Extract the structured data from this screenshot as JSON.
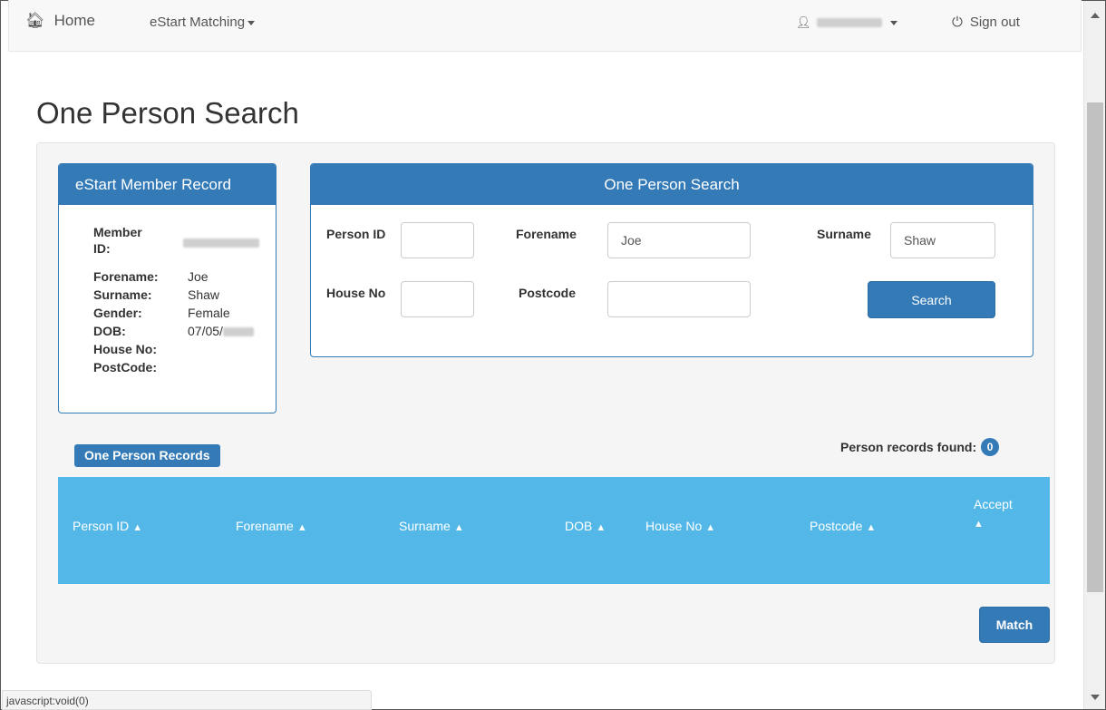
{
  "nav": {
    "home_icon": "home-icon",
    "home_label": "Home",
    "menu_label": "eStart Matching",
    "user_icon": "user-icon",
    "signout_icon": "power-icon",
    "signout_label": "Sign out"
  },
  "page": {
    "title": "One Person Search"
  },
  "member": {
    "heading": "eStart Member Record",
    "labels": {
      "member_id": "Member ID:",
      "forename": "Forename:",
      "surname": "Surname:",
      "gender": "Gender:",
      "dob": "DOB:",
      "house_no": "House No:",
      "postcode": "PostCode:"
    },
    "values": {
      "forename": "Joe",
      "surname": "Shaw",
      "gender": "Female",
      "dob": "07/05/"
    }
  },
  "search": {
    "heading": "One Person Search",
    "person_id_label": "Person ID",
    "person_id_value": "",
    "forename_label": "Forename",
    "forename_value": "Joe",
    "surname_label": "Surname",
    "surname_value": "Shaw",
    "house_no_label": "House No",
    "house_no_value": "",
    "postcode_label": "Postcode",
    "postcode_value": "",
    "search_button": "Search"
  },
  "records": {
    "badge_label": "One Person Records",
    "found_label": "Person records found:",
    "found_count": "0",
    "columns": [
      "Person ID",
      "Forename",
      "Surname",
      "DOB",
      "House No",
      "Postcode",
      "Accept"
    ],
    "sort_icon": "sort-icon"
  },
  "match_button": "Match",
  "status_text": "javascript:void(0)",
  "colors": {
    "primary": "#337ab7",
    "table_header": "#53b8e8"
  }
}
